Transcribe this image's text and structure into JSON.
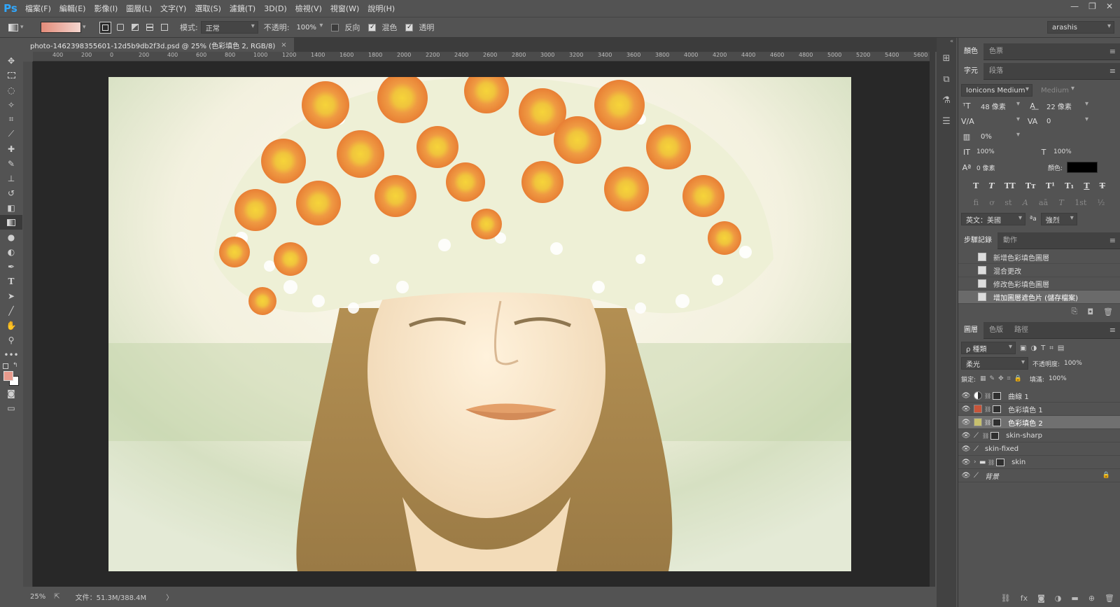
{
  "app": {
    "logo": "Ps"
  },
  "menu": [
    "檔案(F)",
    "編輯(E)",
    "影像(I)",
    "圖層(L)",
    "文字(Y)",
    "選取(S)",
    "濾鏡(T)",
    "3D(D)",
    "檢視(V)",
    "視窗(W)",
    "說明(H)"
  ],
  "window_controls": [
    "—",
    "❐",
    "✕"
  ],
  "options": {
    "mode_label": "模式:",
    "mode_value": "正常",
    "opacity_label": "不透明:",
    "opacity_value": "100%",
    "reverse_label": "反向",
    "dither_label": "混色",
    "transparency_label": "透明",
    "reverse_checked": false,
    "dither_checked": true,
    "transparency_checked": true,
    "workspace": "arashis",
    "gradient_colors": [
      "#e38b79",
      "#f4d6cf"
    ]
  },
  "document": {
    "tab_title": "photo-1462398355601-12d5b9db2f3d.psd @ 25% (色彩填色 2, RGB/8)",
    "close": "×"
  },
  "ruler_top": [
    "400",
    "200",
    "0",
    "200",
    "400",
    "600",
    "800",
    "1000",
    "1200",
    "1400",
    "1600",
    "1800",
    "2000",
    "2200",
    "2400",
    "2600",
    "2800",
    "3000",
    "3200",
    "3400",
    "3600",
    "3800",
    "4000",
    "4200",
    "4400",
    "4600",
    "4800",
    "5000",
    "5200",
    "5400",
    "5600"
  ],
  "status": {
    "zoom": "25%",
    "doc_size": "文件：51.3M/388.4M",
    "arrow": "〉"
  },
  "panels": {
    "color_tabs": [
      "顏色",
      "色票"
    ],
    "char_tabs": [
      "字元",
      "段落"
    ],
    "character": {
      "font_family": "Ionicons Medium",
      "font_style": "Medium",
      "font_size": "48 像素",
      "leading": "22 像素",
      "kerning_label": "V/A",
      "tracking": "0",
      "scale_pct": "0%",
      "vscale": "100%",
      "hscale": "100%",
      "baseline": "0 像素",
      "color_label": "顏色:",
      "color_value": "#000000",
      "language": "英文：美國",
      "aa_label": "ªa",
      "antialias": "強烈",
      "glyphs_style": [
        "T",
        "T",
        "TT",
        "Tт",
        "T¹",
        "T₁",
        "T",
        "T"
      ],
      "glyphs_open": [
        "fi",
        "ơ",
        "st",
        "A",
        "aā",
        "T",
        "1st",
        "½"
      ]
    },
    "history_tabs": [
      "步驟記錄",
      "動作"
    ],
    "history": [
      "新增色彩填色圖層",
      "混合更改",
      "修改色彩填色圖層",
      "增加圖層遮色片 (儲存檔案)"
    ],
    "layers_tabs": [
      "圖層",
      "色版",
      "路徑"
    ],
    "layers": {
      "filter_kind": "ρ 種類",
      "blend_mode": "柔光",
      "opacity_label": "不透明度:",
      "opacity_value": "100%",
      "lock_label": "鎖定:",
      "fill_label": "填滿:",
      "fill_value": "100%",
      "items": [
        {
          "name": "曲線 1",
          "thumb": "#e8e8e8",
          "selected": false
        },
        {
          "name": "色彩填色 1",
          "thumb": "#c8553a",
          "selected": false
        },
        {
          "name": "色彩填色 2",
          "thumb": "#c7c06e",
          "selected": true
        },
        {
          "name": "skin-sharp",
          "thumb": "",
          "selected": false
        },
        {
          "name": "skin-fixed",
          "thumb": "",
          "selected": false
        },
        {
          "name": "skin",
          "thumb": "",
          "selected": false
        },
        {
          "name": "背景",
          "thumb": "",
          "selected": false
        }
      ]
    }
  }
}
